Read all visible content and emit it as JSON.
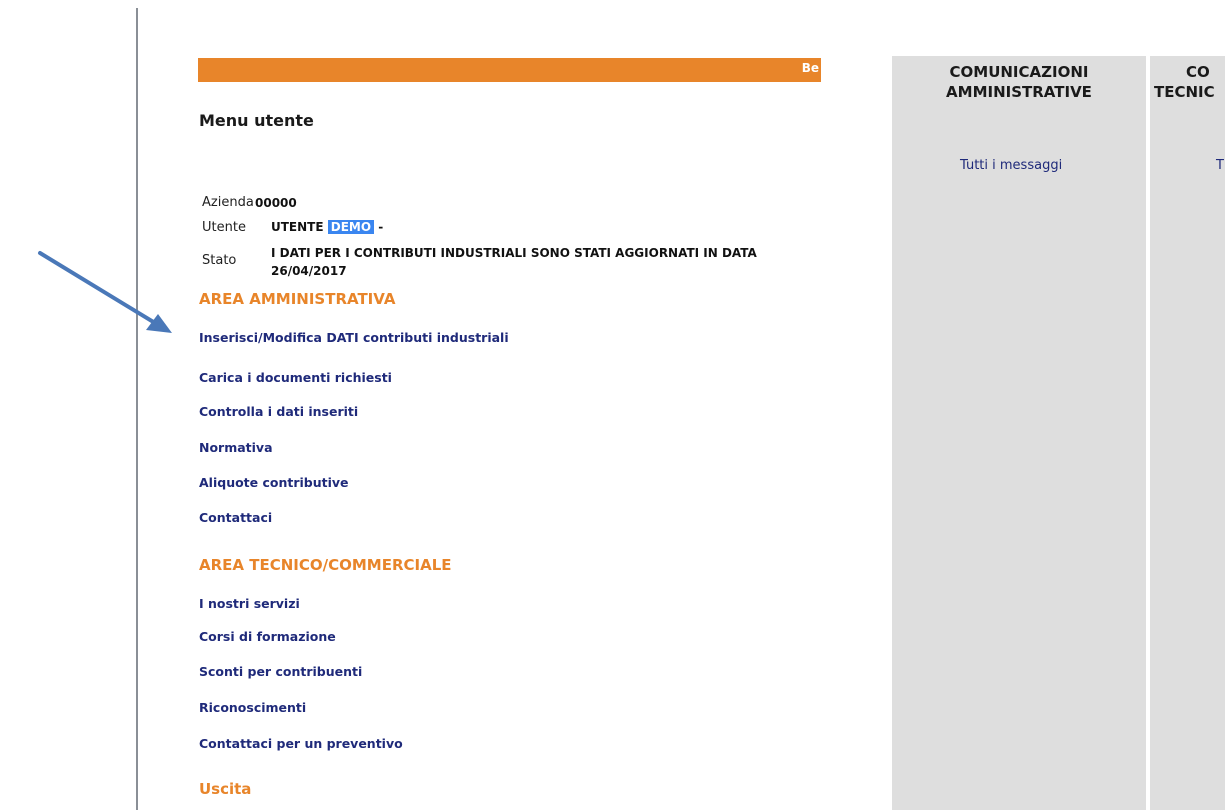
{
  "banner": {
    "marquee_text": "Be"
  },
  "menu": {
    "title": "Menu utente"
  },
  "info": {
    "azienda_label": "Azienda",
    "azienda_value": "00000",
    "utente_label": "Utente",
    "utente_value": "UTENTE",
    "utente_highlight": "DEMO",
    "utente_suffix": "-",
    "stato_label": "Stato",
    "stato_value": "I DATI PER I CONTRIBUTI INDUSTRIALI SONO STATI AGGIORNATI IN DATA 26/04/2017"
  },
  "area_amministrativa": {
    "title": "AREA AMMINISTRATIVA",
    "links": [
      "Inserisci/Modifica DATI contributi industriali",
      "Carica i documenti richiesti",
      "Controlla i dati inseriti",
      "Normativa",
      "Aliquote contributive",
      "Contattaci"
    ]
  },
  "area_tecnico": {
    "title": "AREA TECNICO/COMMERCIALE",
    "links": [
      "I nostri servizi",
      "Corsi di formazione",
      "Sconti per contribuenti",
      "Riconoscimenti",
      "Contattaci per un preventivo"
    ]
  },
  "uscita": {
    "label": "Uscita"
  },
  "comunicazioni_amministrative": {
    "header_line1": "COMUNICAZIONI",
    "header_line2": "AMMINISTRATIVE",
    "link": "Tutti i messaggi"
  },
  "comunicazioni_tecniche": {
    "header_line1": "CO",
    "header_line2": "TECNIC",
    "link": "T"
  },
  "colors": {
    "accent_orange": "#e8852a",
    "link_blue": "#1f2a7a",
    "panel_gray": "#dedede",
    "highlight_blue": "#3a86f0",
    "arrow_blue": "#4a78b8"
  }
}
